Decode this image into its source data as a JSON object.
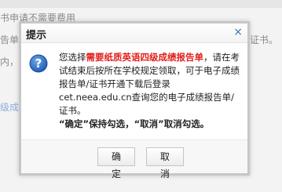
{
  "background": {
    "line1": "书申请不需要费用",
    "line2_left": "告单/",
    "line2_right": "/证书。",
    "line3": "内，考",
    "line4": "级成绩"
  },
  "dialog": {
    "title": "提示",
    "close_symbol": "×",
    "message": {
      "part1": "您选择",
      "highlight": "需要纸质英语四级成绩报告单",
      "part2": "，请在考试结束后按所在学校规定领取，可于电子成绩报告单/证书开通下载后登录cet.neea.edu.cn查询您的电子成绩报告单/证书。",
      "note": "“确定”保持勾选，“取消”取消勾选。"
    },
    "buttons": {
      "ok": "确定",
      "cancel": "取消"
    }
  },
  "colors": {
    "highlight": "#e0201b",
    "link_blue": "#3a73c4",
    "icon_blue": "#2a6cc0"
  },
  "icons": {
    "dialog_icon": "question-icon"
  }
}
